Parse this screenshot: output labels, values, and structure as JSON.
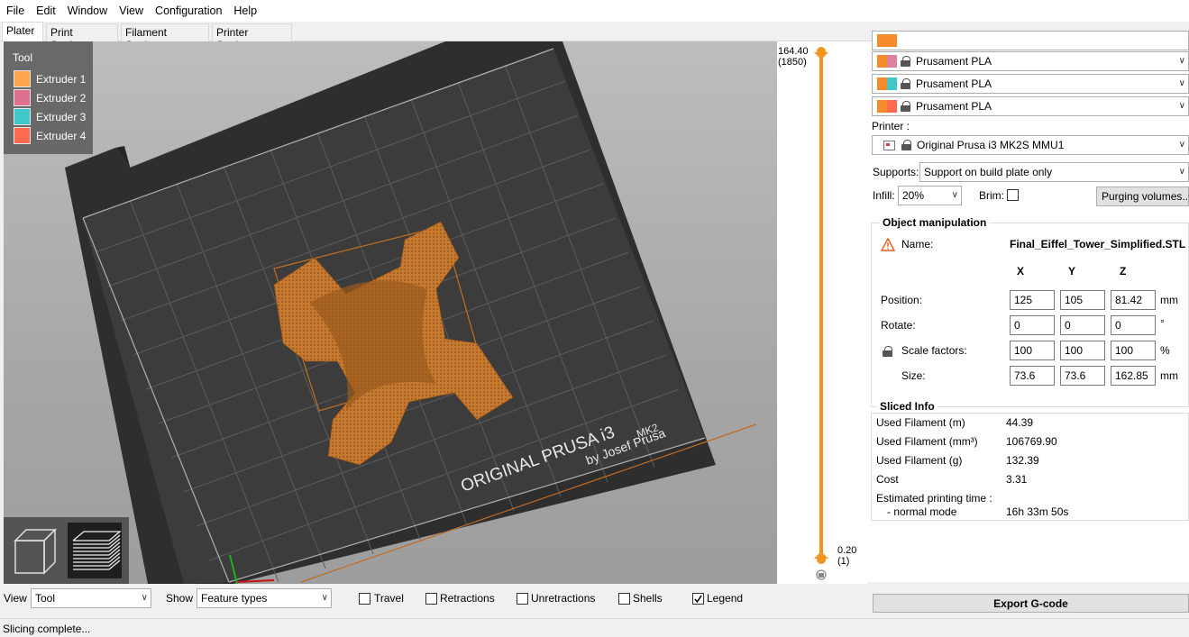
{
  "menu": [
    "File",
    "Edit",
    "Window",
    "View",
    "Configuration",
    "Help"
  ],
  "tabs": [
    "Plater",
    "Print Settings",
    "Filament Settings",
    "Printer Settings"
  ],
  "legend": {
    "title": "Tool",
    "items": [
      {
        "label": "Extruder 1",
        "color": "#ffa64d"
      },
      {
        "label": "Extruder 2",
        "color": "#e07090"
      },
      {
        "label": "Extruder 3",
        "color": "#40c8c8"
      },
      {
        "label": "Extruder 4",
        "color": "#ff6a50"
      }
    ]
  },
  "bed": {
    "brand": "ORIGINAL PRUSA i3",
    "model": "MK2",
    "byline": "by Josef Prusa",
    "object_color": "#c8782e"
  },
  "slider": {
    "top_value": "164.40",
    "top_layer": "(1850)",
    "bottom_value": "0.20",
    "bottom_layer": "(1)",
    "accent": "#f39421"
  },
  "filaments": [
    {
      "name": "Prusament PLA",
      "color1": "#f58a2a",
      "color2": "#e080a0"
    },
    {
      "name": "Prusament PLA",
      "color1": "#f58a2a",
      "color2": "#40c8c8"
    },
    {
      "name": "Prusament PLA",
      "color1": "#f58a2a",
      "color2": "#ff6a50"
    }
  ],
  "printer": {
    "label": "Printer :",
    "value": "Original Prusa i3 MK2S MMU1"
  },
  "supports": {
    "label": "Supports:",
    "value": "Support on build plate only"
  },
  "infill": {
    "label": "Infill:",
    "value": "20%"
  },
  "brim": {
    "label": "Brim:",
    "checked": false
  },
  "purging_button": "Purging volumes...",
  "object_manipulation": {
    "title": "Object manipulation",
    "name_label": "Name:",
    "name_value": "Final_Eiffel_Tower_Simplified.STL",
    "axes": [
      "X",
      "Y",
      "Z"
    ],
    "rows": [
      {
        "label": "Position:",
        "values": [
          "125",
          "105",
          "81.42"
        ],
        "unit": "mm"
      },
      {
        "label": "Rotate:",
        "values": [
          "0",
          "0",
          "0"
        ],
        "unit": "°"
      },
      {
        "label": "Scale factors:",
        "values": [
          "100",
          "100",
          "100"
        ],
        "unit": "%"
      },
      {
        "label": "Size:",
        "values": [
          "73.6",
          "73.6",
          "162.85"
        ],
        "unit": "mm"
      }
    ]
  },
  "sliced_info": {
    "title": "Sliced Info",
    "rows": [
      {
        "label": "Used Filament (m)",
        "value": "44.39"
      },
      {
        "label": "Used Filament (mm³)",
        "value": "106769.90"
      },
      {
        "label": "Used Filament (g)",
        "value": "132.39"
      },
      {
        "label": "Cost",
        "value": "3.31"
      }
    ],
    "time_label": "Estimated printing time :",
    "mode_label": "- normal mode",
    "mode_value": "16h 33m 50s"
  },
  "bottom": {
    "view_label": "View",
    "view_value": "Tool",
    "show_label": "Show",
    "show_value": "Feature types",
    "checks": [
      {
        "label": "Travel",
        "checked": false
      },
      {
        "label": "Retractions",
        "checked": false
      },
      {
        "label": "Unretractions",
        "checked": false
      },
      {
        "label": "Shells",
        "checked": false
      },
      {
        "label": "Legend",
        "checked": true
      }
    ]
  },
  "export_button": "Export G-code",
  "status": "Slicing complete..."
}
